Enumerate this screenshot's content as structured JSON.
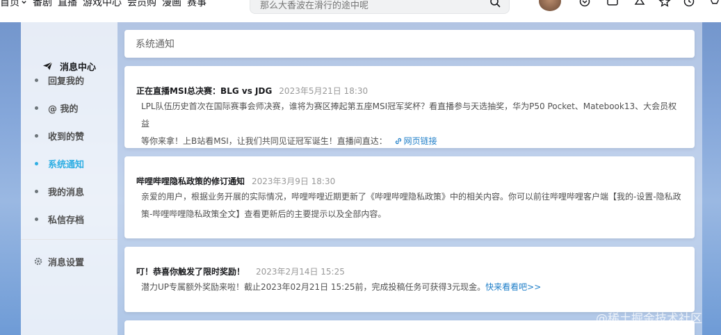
{
  "nav": {
    "home_label": "首页",
    "links": [
      "番剧",
      "直播",
      "游戏中心",
      "会员购",
      "漫画",
      "赛事"
    ]
  },
  "search": {
    "placeholder": "那么大香波在滑行的途中呢"
  },
  "sidebar": {
    "title": "消息中心",
    "items": [
      {
        "label": "回复我的"
      },
      {
        "label": "@ 我的"
      },
      {
        "label": "收到的赞"
      },
      {
        "label": "系统通知",
        "active": true
      },
      {
        "label": "我的消息"
      },
      {
        "label": "私信存档"
      }
    ],
    "settings_label": "消息设置"
  },
  "header": {
    "title": "系统通知"
  },
  "notifications": [
    {
      "title": "正在直播MSI总决赛：BLG vs JDG",
      "time": "2023年5月21日 18:30",
      "line1": "LPL队伍历史首次在国际赛事会师决赛，谁将为赛区捧起第五座MSI冠军奖杯？看直播参与天选抽奖，华为P50 Pocket、Matebook13、大会员权益",
      "line2": "等你来拿！上B站看MSI，让我们共同见证冠军诞生！直播间直达：",
      "link": "网页链接"
    },
    {
      "title": "哔哩哔哩隐私政策的修订通知",
      "time": "2023年3月9日 18:30",
      "line1": "亲爱的用户，根据业务开展的实际情况，哔哩哔哩近期更新了《哔哩哔哩隐私政策》中的相关内容。你可以前往哔哩哔哩客户端【我的-设置-隐私政",
      "line2": "策-哔哩哔哩隐私政策全文】查看更新后的主要提示以及全部内容。"
    },
    {
      "title": "叮！恭喜你触发了限时奖励！",
      "time": "2023年2月14日 15:25",
      "line1": "潜力UP专属额外奖励来啦！截止2023年02月21日 15:25前，完成投稿任务可获得3元现金。",
      "link": "快来看看吧>>"
    }
  ],
  "watermark": "@稀土掘金技术社区"
}
